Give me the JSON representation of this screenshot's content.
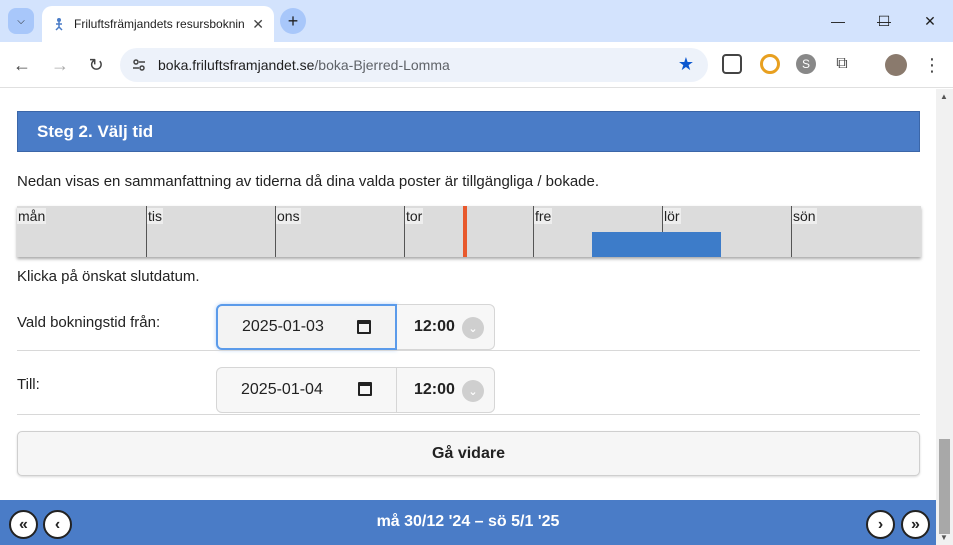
{
  "browser": {
    "tab_title": "Friluftsfrämjandets resursbokning",
    "url_host": "boka.friluftsframjandet.se",
    "url_path": "/boka-Bjerred-Lomma"
  },
  "page": {
    "step_title": "Steg 2. Välj tid",
    "intro_text": "Nedan visas en sammanfattning av tiderna då dina valda poster är tillgängliga / bokade.",
    "days": [
      "mån",
      "tis",
      "ons",
      "tor",
      "fre",
      "lör",
      "sön"
    ],
    "hint_text": "Klicka på önskat slutdatum.",
    "from_label": "Vald bokningstid från:",
    "from_date": "2025-01-03",
    "from_time": "12:00",
    "to_label": "Till:",
    "to_date": "2025-01-04",
    "to_time": "12:00",
    "next_label": "Gå vidare",
    "week_range": "må 30/12 '24 – sö 5/1 '25"
  },
  "colors": {
    "accent": "#4a7cc7",
    "booked": "#3d7cc9",
    "now_marker": "#e8592d"
  }
}
